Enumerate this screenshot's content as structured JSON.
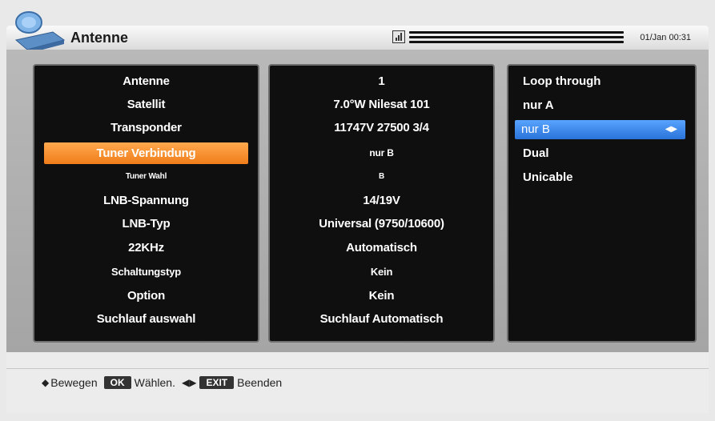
{
  "header": {
    "title": "Antenne",
    "datetime": "01/Jan 00:31"
  },
  "labels": [
    "Antenne",
    "Satellit",
    "Transponder",
    "Tuner Verbindung",
    "Tuner Wahl",
    "LNB-Spannung",
    "LNB-Typ",
    "22KHz",
    "Schaltungstyp",
    "Option",
    "Suchlauf auswahl"
  ],
  "values": [
    "1",
    "7.0°W Nilesat 101",
    "11747V 27500 3/4",
    "nur B",
    "B",
    "14/19V",
    "Universal (9750/10600)",
    "Automatisch",
    "Kein",
    "Kein",
    "Suchlauf Automatisch"
  ],
  "options": {
    "items": [
      "Loop through",
      "nur A",
      "nur B",
      "Dual",
      "Unicable"
    ],
    "selected_index": 2
  },
  "footer": {
    "move": "Bewegen",
    "ok_key": "OK",
    "select": "Wählen.",
    "exit_key": "EXIT",
    "exit": "Beenden"
  },
  "colors": {
    "active_row": "#f07d1a",
    "selected_option": "#2a73d9",
    "panel_background": "#0f0f0f"
  },
  "icons": {
    "logo": "satellite-dish-icon",
    "signal": "signal-icon",
    "move": "up-down-arrows-icon",
    "change": "left-right-arrows-icon"
  }
}
